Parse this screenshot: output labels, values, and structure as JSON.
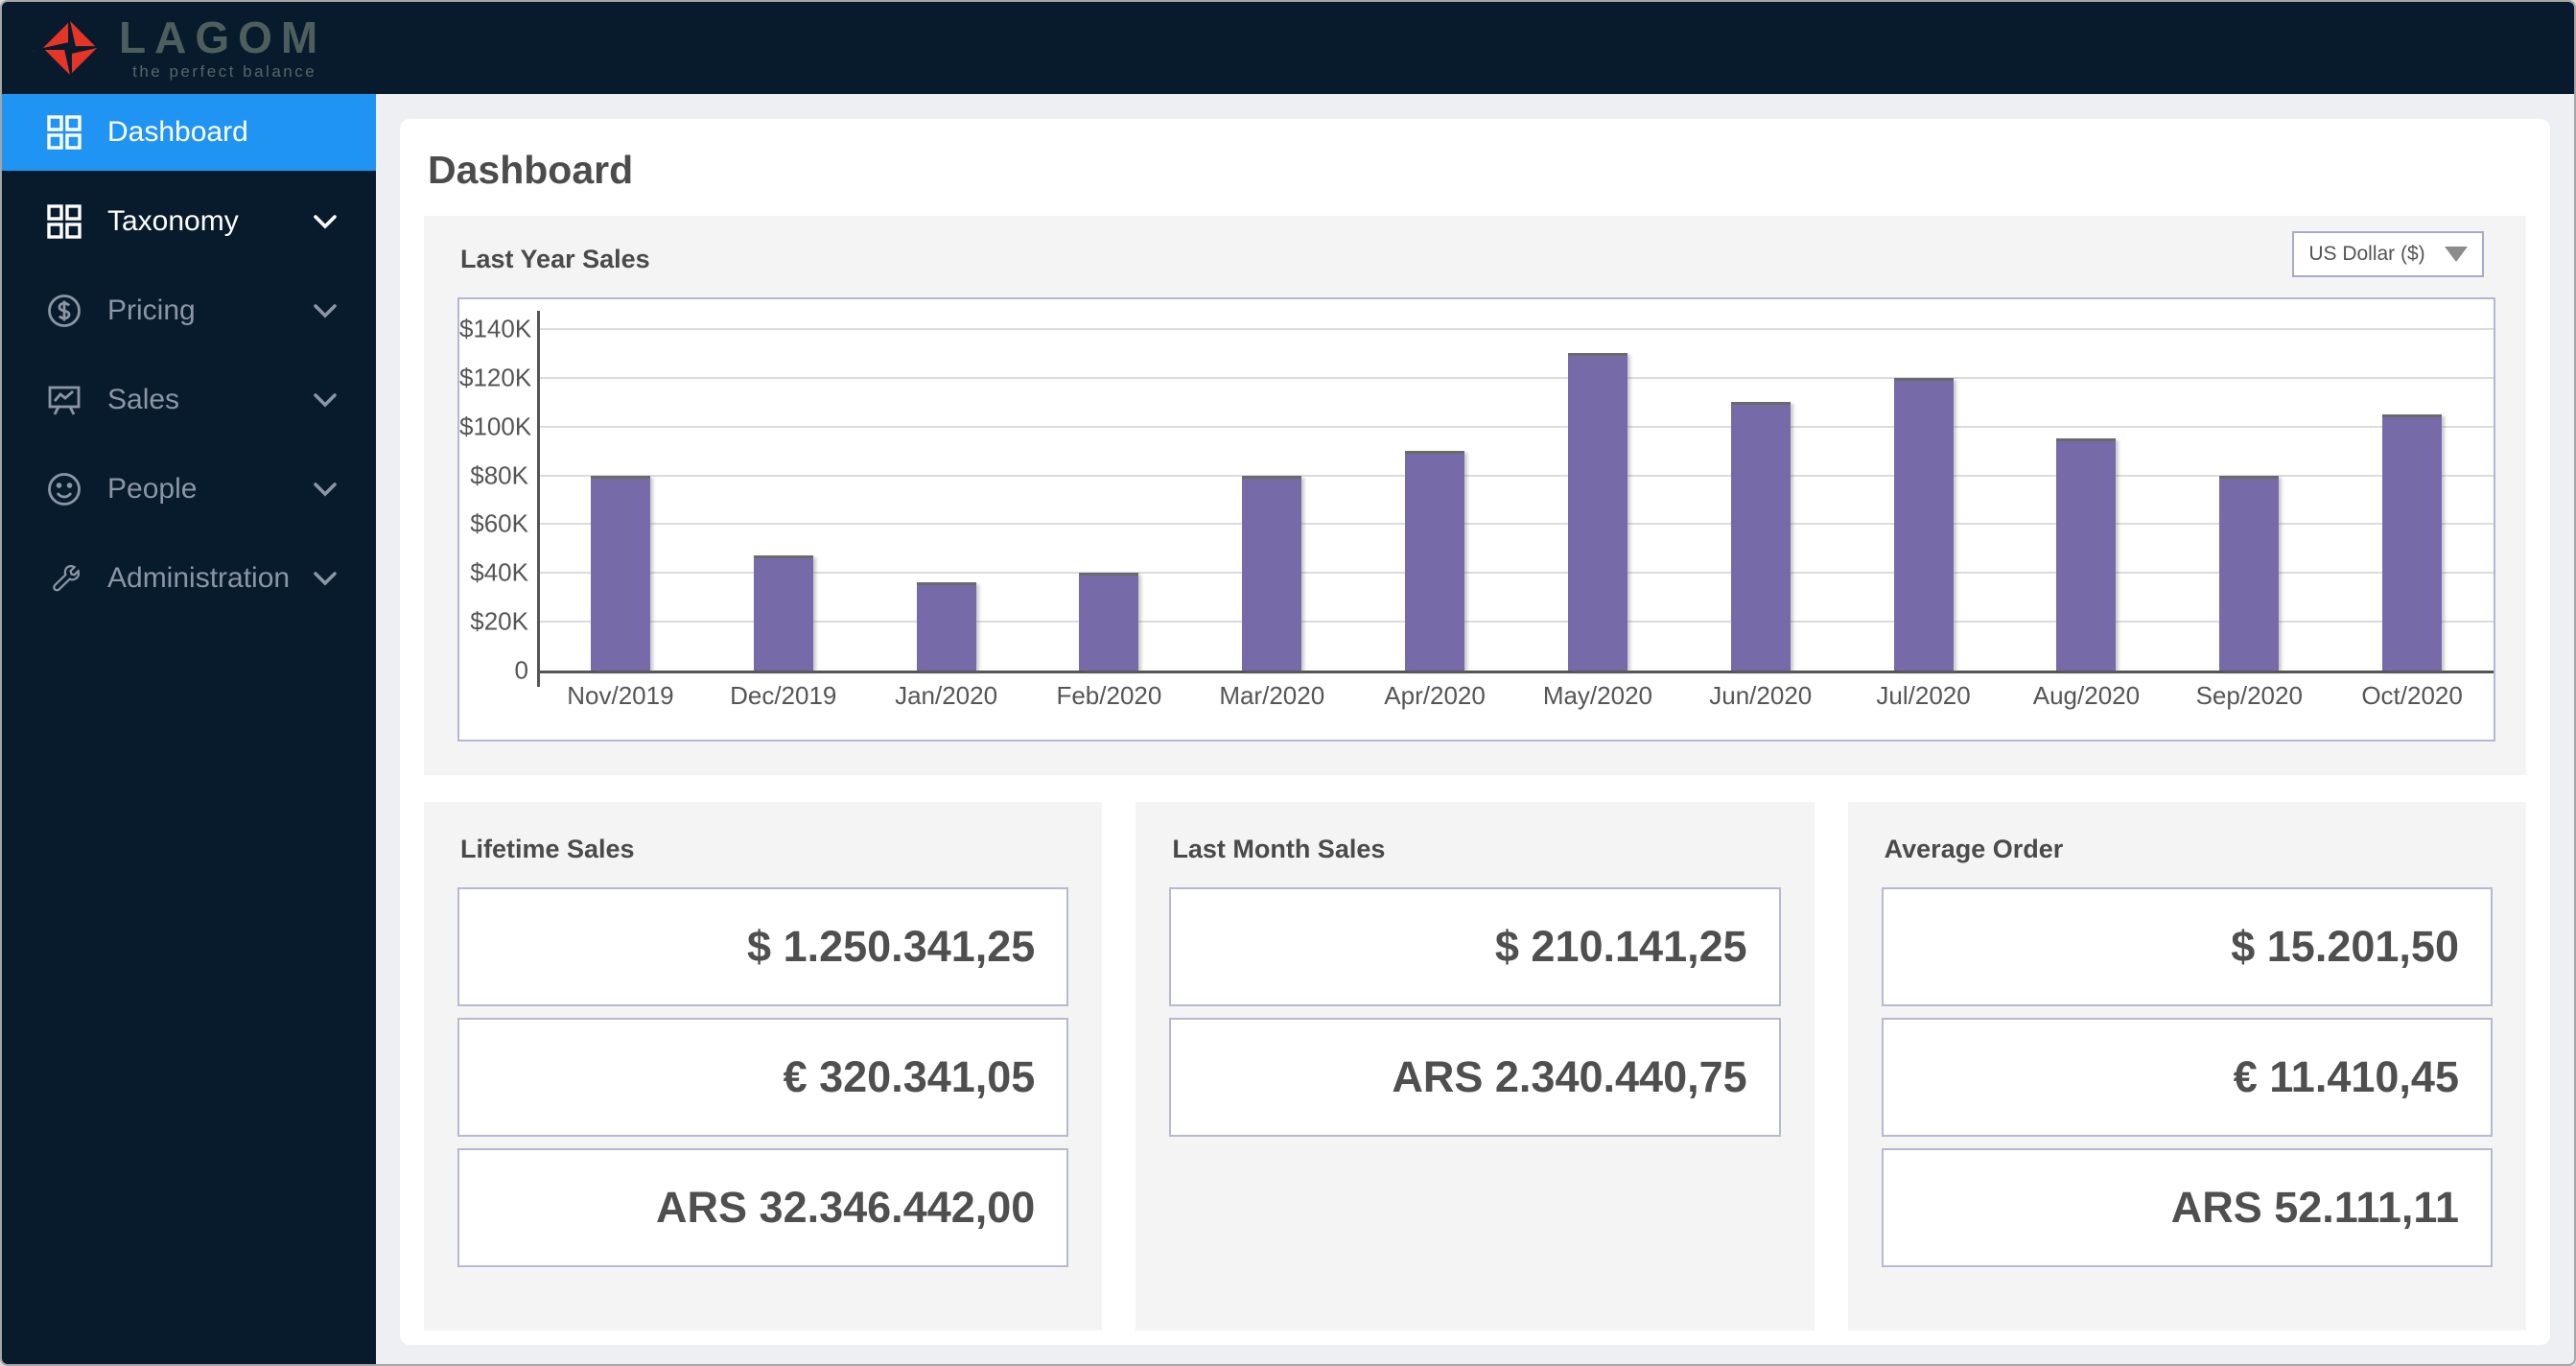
{
  "sidebar": {
    "logo": {
      "brand": "LAGOM",
      "tagline": "the perfect balance"
    },
    "items": [
      {
        "label": "Dashboard",
        "icon": "grid-icon",
        "active": true,
        "chevron": false
      },
      {
        "label": "Taxonomy",
        "icon": "grid-icon",
        "active": false,
        "chevron": true
      },
      {
        "label": "Pricing",
        "icon": "dollar-circle-icon",
        "active": false,
        "chevron": true
      },
      {
        "label": "Sales",
        "icon": "presentation-chart-icon",
        "active": false,
        "chevron": true
      },
      {
        "label": "People",
        "icon": "smiley-icon",
        "active": false,
        "chevron": true
      },
      {
        "label": "Administration",
        "icon": "wrench-icon",
        "active": false,
        "chevron": true
      }
    ]
  },
  "main": {
    "page_title": "Dashboard",
    "chart_card": {
      "title": "Last Year Sales",
      "currency_selector": {
        "value": "US Dollar ($)",
        "icon": "dropdown-arrow-icon"
      }
    },
    "stat_cards": [
      {
        "title": "Lifetime Sales",
        "values": [
          "$ 1.250.341,25",
          "€ 320.341,05",
          "ARS 32.346.442,00"
        ]
      },
      {
        "title": "Last Month Sales",
        "values": [
          "$ 210.141,25",
          "ARS 2.340.440,75"
        ]
      },
      {
        "title": "Average Order",
        "values": [
          "$ 15.201,50",
          "€ 11.410,45",
          "ARS 52.111,11"
        ]
      }
    ]
  },
  "chart_data": {
    "type": "bar",
    "title": "Last Year Sales",
    "categories": [
      "Nov/2019",
      "Dec/2019",
      "Jan/2020",
      "Feb/2020",
      "Mar/2020",
      "Apr/2020",
      "May/2020",
      "Jun/2020",
      "Jul/2020",
      "Aug/2020",
      "Sep/2020",
      "Oct/2020"
    ],
    "values": [
      80000,
      47000,
      36000,
      40000,
      80000,
      90000,
      130000,
      110000,
      120000,
      95000,
      80000,
      105000
    ],
    "unit": "USD",
    "xlabel": "",
    "ylabel": "",
    "ylim": [
      0,
      140000
    ],
    "ytick_labels": [
      "$140K",
      "$120K",
      "$100K",
      "$80K",
      "$60K",
      "$40K",
      "$20K",
      "0"
    ],
    "ytick_values": [
      140000,
      120000,
      100000,
      80000,
      60000,
      40000,
      20000,
      0
    ],
    "grid": true,
    "legend": false,
    "bar_color": "#766aa8"
  },
  "colors": {
    "sidebar_bg": "#081b2d",
    "active_blue": "#2094f3",
    "bar_purple": "#766aa8",
    "card_gray": "#f4f4f5",
    "periwinkle_border": "#b5b6d6",
    "text_dark": "#4c4c4c",
    "logo_red": "#e63427"
  }
}
